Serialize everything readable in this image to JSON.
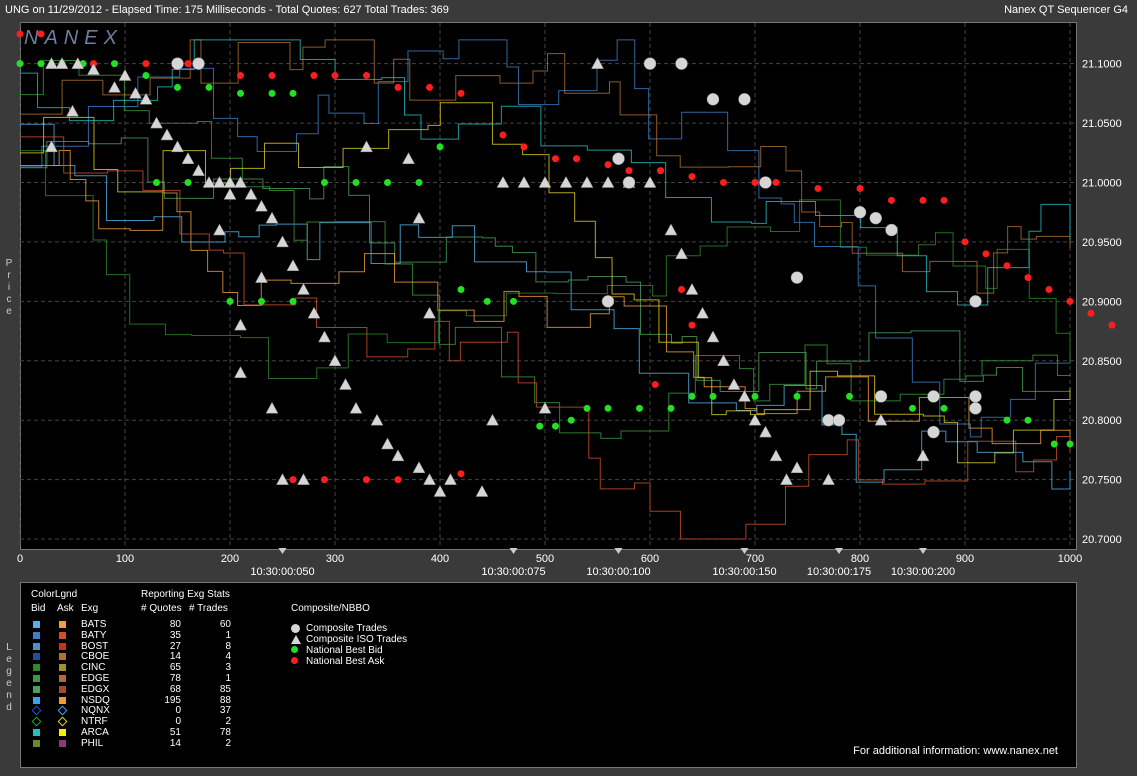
{
  "header": {
    "left": "UNG on 11/29/2012  -  Elapsed Time: 175 Milliseconds  -  Total Quotes: 627  Total Trades: 369",
    "right": "Nanex QT Sequencer G4"
  },
  "side_labels": {
    "price": "Price",
    "legend": "Legend"
  },
  "watermark": "NANEX",
  "chart_data": {
    "type": "scatter",
    "title": "",
    "xlabel": "",
    "ylabel": "Price",
    "xlim": [
      0,
      1000
    ],
    "ylim": [
      20.695,
      21.13
    ],
    "x_ticks": [
      0,
      100,
      200,
      300,
      400,
      500,
      600,
      700,
      800,
      900,
      1000
    ],
    "y_ticks": [
      "21.1000",
      "21.0500",
      "21.0000",
      "20.9500",
      "20.9000",
      "20.8500",
      "20.8000",
      "20.7500",
      "20.7000"
    ],
    "time_markers": [
      {
        "x": 250,
        "label": "10:30:00:050"
      },
      {
        "x": 470,
        "label": "10:30:00:075"
      },
      {
        "x": 570,
        "label": "10:30:00:100"
      },
      {
        "x": 690,
        "label": "10:30:00:150"
      },
      {
        "x": 780,
        "label": "10:30:00:175"
      },
      {
        "x": 860,
        "label": "10:30:00:200"
      }
    ],
    "series": [
      {
        "name": "National Best Bid",
        "color": "#22e022",
        "points": [
          [
            0,
            21.1
          ],
          [
            20,
            21.1
          ],
          [
            40,
            21.1
          ],
          [
            60,
            21.1
          ],
          [
            90,
            21.1
          ],
          [
            120,
            21.09
          ],
          [
            150,
            21.08
          ],
          [
            180,
            21.08
          ],
          [
            210,
            21.075
          ],
          [
            240,
            21.075
          ],
          [
            260,
            21.075
          ],
          [
            130,
            21.0
          ],
          [
            160,
            21.0
          ],
          [
            200,
            20.9
          ],
          [
            230,
            20.9
          ],
          [
            260,
            20.9
          ],
          [
            290,
            21.0
          ],
          [
            320,
            21.0
          ],
          [
            350,
            21.0
          ],
          [
            380,
            21.0
          ],
          [
            400,
            21.03
          ],
          [
            420,
            20.91
          ],
          [
            445,
            20.9
          ],
          [
            470,
            20.9
          ],
          [
            495,
            20.795
          ],
          [
            510,
            20.795
          ],
          [
            525,
            20.8
          ],
          [
            540,
            20.81
          ],
          [
            560,
            20.81
          ],
          [
            590,
            20.81
          ],
          [
            620,
            20.81
          ],
          [
            640,
            20.82
          ],
          [
            660,
            20.82
          ],
          [
            700,
            20.82
          ],
          [
            740,
            20.82
          ],
          [
            790,
            20.82
          ],
          [
            820,
            20.82
          ],
          [
            850,
            20.81
          ],
          [
            880,
            20.81
          ],
          [
            910,
            20.81
          ],
          [
            940,
            20.8
          ],
          [
            960,
            20.8
          ],
          [
            985,
            20.78
          ],
          [
            1000,
            20.78
          ]
        ]
      },
      {
        "name": "National Best Ask",
        "color": "#ff1e1e",
        "points": [
          [
            0,
            21.125
          ],
          [
            20,
            21.125
          ],
          [
            70,
            21.1
          ],
          [
            120,
            21.1
          ],
          [
            160,
            21.1
          ],
          [
            210,
            21.09
          ],
          [
            240,
            21.09
          ],
          [
            280,
            21.09
          ],
          [
            300,
            21.09
          ],
          [
            330,
            21.09
          ],
          [
            360,
            21.08
          ],
          [
            390,
            21.08
          ],
          [
            420,
            21.075
          ],
          [
            460,
            21.04
          ],
          [
            480,
            21.03
          ],
          [
            510,
            21.02
          ],
          [
            530,
            21.02
          ],
          [
            560,
            21.015
          ],
          [
            580,
            21.01
          ],
          [
            610,
            21.01
          ],
          [
            640,
            21.005
          ],
          [
            670,
            21.0
          ],
          [
            700,
            21.0
          ],
          [
            720,
            21.0
          ],
          [
            760,
            20.995
          ],
          [
            800,
            20.995
          ],
          [
            830,
            20.985
          ],
          [
            860,
            20.985
          ],
          [
            880,
            20.985
          ],
          [
            900,
            20.95
          ],
          [
            920,
            20.94
          ],
          [
            940,
            20.93
          ],
          [
            960,
            20.92
          ],
          [
            980,
            20.91
          ],
          [
            1000,
            20.9
          ],
          [
            1020,
            20.89
          ],
          [
            1040,
            20.88
          ],
          [
            260,
            20.75
          ],
          [
            290,
            20.75
          ],
          [
            330,
            20.75
          ],
          [
            360,
            20.75
          ],
          [
            420,
            20.755
          ],
          [
            605,
            20.83
          ],
          [
            630,
            20.91
          ],
          [
            640,
            20.88
          ]
        ]
      },
      {
        "name": "Composite ISO Trades",
        "color": "#d6d6d6",
        "points": [
          [
            30,
            21.1
          ],
          [
            40,
            21.1
          ],
          [
            55,
            21.1
          ],
          [
            70,
            21.095
          ],
          [
            90,
            21.08
          ],
          [
            100,
            21.09
          ],
          [
            110,
            21.075
          ],
          [
            120,
            21.07
          ],
          [
            130,
            21.05
          ],
          [
            140,
            21.04
          ],
          [
            150,
            21.03
          ],
          [
            160,
            21.02
          ],
          [
            170,
            21.01
          ],
          [
            180,
            21.0
          ],
          [
            190,
            21.0
          ],
          [
            200,
            21.0
          ],
          [
            210,
            21.0
          ],
          [
            220,
            20.99
          ],
          [
            230,
            20.98
          ],
          [
            240,
            20.97
          ],
          [
            250,
            20.95
          ],
          [
            260,
            20.93
          ],
          [
            270,
            20.91
          ],
          [
            280,
            20.89
          ],
          [
            290,
            20.87
          ],
          [
            300,
            20.85
          ],
          [
            310,
            20.83
          ],
          [
            320,
            20.81
          ],
          [
            340,
            20.8
          ],
          [
            350,
            20.78
          ],
          [
            360,
            20.77
          ],
          [
            380,
            20.76
          ],
          [
            390,
            20.75
          ],
          [
            400,
            20.74
          ],
          [
            410,
            20.75
          ],
          [
            440,
            20.74
          ],
          [
            460,
            21.0
          ],
          [
            480,
            21.0
          ],
          [
            500,
            21.0
          ],
          [
            520,
            21.0
          ],
          [
            540,
            21.0
          ],
          [
            560,
            21.0
          ],
          [
            580,
            21.0
          ],
          [
            600,
            21.0
          ],
          [
            620,
            20.96
          ],
          [
            630,
            20.94
          ],
          [
            640,
            20.91
          ],
          [
            650,
            20.89
          ],
          [
            660,
            20.87
          ],
          [
            670,
            20.85
          ],
          [
            680,
            20.83
          ],
          [
            690,
            20.82
          ],
          [
            700,
            20.8
          ],
          [
            710,
            20.79
          ],
          [
            720,
            20.77
          ],
          [
            730,
            20.75
          ],
          [
            740,
            20.76
          ],
          [
            770,
            20.75
          ],
          [
            820,
            20.8
          ],
          [
            860,
            20.77
          ],
          [
            550,
            21.1
          ],
          [
            50,
            21.06
          ],
          [
            30,
            21.03
          ],
          [
            200,
            20.99
          ],
          [
            190,
            20.96
          ],
          [
            210,
            20.88
          ],
          [
            230,
            20.92
          ],
          [
            240,
            20.81
          ],
          [
            250,
            20.75
          ],
          [
            270,
            20.75
          ],
          [
            330,
            21.03
          ],
          [
            370,
            21.02
          ],
          [
            380,
            20.97
          ],
          [
            390,
            20.89
          ],
          [
            450,
            20.8
          ],
          [
            500,
            20.81
          ],
          [
            210,
            20.84
          ]
        ]
      },
      {
        "name": "Composite Trades",
        "color": "#d6d6d6",
        "points": [
          [
            150,
            21.1
          ],
          [
            170,
            21.1
          ],
          [
            570,
            21.02
          ],
          [
            580,
            21.0
          ],
          [
            600,
            21.1
          ],
          [
            630,
            21.1
          ],
          [
            660,
            21.07
          ],
          [
            690,
            21.07
          ],
          [
            710,
            21.0
          ],
          [
            740,
            20.92
          ],
          [
            560,
            20.9
          ],
          [
            800,
            20.975
          ],
          [
            815,
            20.97
          ],
          [
            830,
            20.96
          ],
          [
            910,
            20.9
          ],
          [
            770,
            20.8
          ],
          [
            780,
            20.8
          ],
          [
            820,
            20.82
          ],
          [
            870,
            20.82
          ],
          [
            870,
            20.79
          ],
          [
            910,
            20.82
          ],
          [
            910,
            20.81
          ]
        ]
      }
    ]
  },
  "legend": {
    "headers": {
      "colorlgnd": "ColorLgnd",
      "bid": "Bid",
      "ask": "Ask",
      "exg": "Exg",
      "reporting": "Reporting Exg Stats",
      "quotes": "# Quotes",
      "trades": "# Trades",
      "composite": "Composite/NBBO"
    },
    "exchanges": [
      {
        "name": "BATS",
        "bid": "#4fb3e8",
        "ask": "#f0a040",
        "quotes": "80",
        "trades": "60"
      },
      {
        "name": "BATY",
        "bid": "#3d7fc8",
        "ask": "#d0502a",
        "quotes": "35",
        "trades": "1"
      },
      {
        "name": "BOST",
        "bid": "#4a90d0",
        "ask": "#c83020",
        "quotes": "27",
        "trades": "8"
      },
      {
        "name": "CBOE",
        "bid": "#1e4f9a",
        "ask": "#b07030",
        "quotes": "14",
        "trades": "4"
      },
      {
        "name": "CINC",
        "bid": "#2a8a2a",
        "ask": "#a09030",
        "quotes": "65",
        "trades": "3"
      },
      {
        "name": "EDGE",
        "bid": "#3a9a3a",
        "ask": "#b06a40",
        "quotes": "78",
        "trades": "1"
      },
      {
        "name": "EDGX",
        "bid": "#4aa05a",
        "ask": "#a04a30",
        "quotes": "68",
        "trades": "85"
      },
      {
        "name": "NSDQ",
        "bid": "#3aa0f0",
        "ask": "#f09a30",
        "quotes": "195",
        "trades": "88"
      },
      {
        "name": "NQNX",
        "bid": "#1e50c8",
        "ask": "#3aa0f0",
        "quotes": "0",
        "trades": "37",
        "shape": "diamond"
      },
      {
        "name": "NTRF",
        "bid": "#2aa02a",
        "ask": "#e0d020",
        "quotes": "0",
        "trades": "2",
        "shape": "diamond"
      },
      {
        "name": "ARCA",
        "bid": "#20c0c0",
        "ask": "#f0f000",
        "quotes": "51",
        "trades": "78"
      },
      {
        "name": "PHIL",
        "bid": "#6a8a2a",
        "ask": "#8a3a7a",
        "quotes": "14",
        "trades": "2"
      }
    ],
    "composite_items": [
      {
        "label": "Composite Trades",
        "shape": "circle",
        "color": "#d6d6d6"
      },
      {
        "label": "Composite ISO Trades",
        "shape": "triangle",
        "color": "#d6d6d6"
      },
      {
        "label": "National Best Bid",
        "shape": "dot",
        "color": "#22e022"
      },
      {
        "label": "National Best Ask",
        "shape": "dot",
        "color": "#ff1e1e"
      }
    ],
    "info": "For additional information: www.nanex.net"
  }
}
